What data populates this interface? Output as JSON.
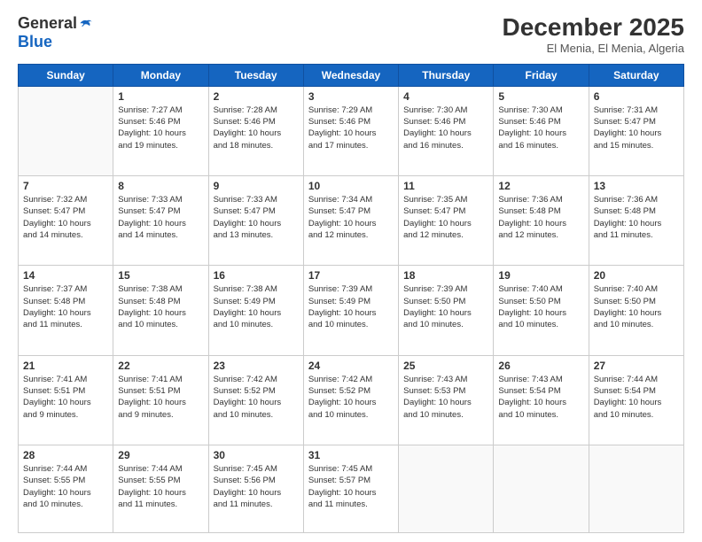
{
  "logo": {
    "general": "General",
    "blue": "Blue"
  },
  "header": {
    "month": "December 2025",
    "location": "El Menia, El Menia, Algeria"
  },
  "days_of_week": [
    "Sunday",
    "Monday",
    "Tuesday",
    "Wednesday",
    "Thursday",
    "Friday",
    "Saturday"
  ],
  "weeks": [
    [
      {
        "day": "",
        "info": ""
      },
      {
        "day": "1",
        "info": "Sunrise: 7:27 AM\nSunset: 5:46 PM\nDaylight: 10 hours\nand 19 minutes."
      },
      {
        "day": "2",
        "info": "Sunrise: 7:28 AM\nSunset: 5:46 PM\nDaylight: 10 hours\nand 18 minutes."
      },
      {
        "day": "3",
        "info": "Sunrise: 7:29 AM\nSunset: 5:46 PM\nDaylight: 10 hours\nand 17 minutes."
      },
      {
        "day": "4",
        "info": "Sunrise: 7:30 AM\nSunset: 5:46 PM\nDaylight: 10 hours\nand 16 minutes."
      },
      {
        "day": "5",
        "info": "Sunrise: 7:30 AM\nSunset: 5:46 PM\nDaylight: 10 hours\nand 16 minutes."
      },
      {
        "day": "6",
        "info": "Sunrise: 7:31 AM\nSunset: 5:47 PM\nDaylight: 10 hours\nand 15 minutes."
      }
    ],
    [
      {
        "day": "7",
        "info": "Sunrise: 7:32 AM\nSunset: 5:47 PM\nDaylight: 10 hours\nand 14 minutes."
      },
      {
        "day": "8",
        "info": "Sunrise: 7:33 AM\nSunset: 5:47 PM\nDaylight: 10 hours\nand 14 minutes."
      },
      {
        "day": "9",
        "info": "Sunrise: 7:33 AM\nSunset: 5:47 PM\nDaylight: 10 hours\nand 13 minutes."
      },
      {
        "day": "10",
        "info": "Sunrise: 7:34 AM\nSunset: 5:47 PM\nDaylight: 10 hours\nand 12 minutes."
      },
      {
        "day": "11",
        "info": "Sunrise: 7:35 AM\nSunset: 5:47 PM\nDaylight: 10 hours\nand 12 minutes."
      },
      {
        "day": "12",
        "info": "Sunrise: 7:36 AM\nSunset: 5:48 PM\nDaylight: 10 hours\nand 12 minutes."
      },
      {
        "day": "13",
        "info": "Sunrise: 7:36 AM\nSunset: 5:48 PM\nDaylight: 10 hours\nand 11 minutes."
      }
    ],
    [
      {
        "day": "14",
        "info": "Sunrise: 7:37 AM\nSunset: 5:48 PM\nDaylight: 10 hours\nand 11 minutes."
      },
      {
        "day": "15",
        "info": "Sunrise: 7:38 AM\nSunset: 5:48 PM\nDaylight: 10 hours\nand 10 minutes."
      },
      {
        "day": "16",
        "info": "Sunrise: 7:38 AM\nSunset: 5:49 PM\nDaylight: 10 hours\nand 10 minutes."
      },
      {
        "day": "17",
        "info": "Sunrise: 7:39 AM\nSunset: 5:49 PM\nDaylight: 10 hours\nand 10 minutes."
      },
      {
        "day": "18",
        "info": "Sunrise: 7:39 AM\nSunset: 5:50 PM\nDaylight: 10 hours\nand 10 minutes."
      },
      {
        "day": "19",
        "info": "Sunrise: 7:40 AM\nSunset: 5:50 PM\nDaylight: 10 hours\nand 10 minutes."
      },
      {
        "day": "20",
        "info": "Sunrise: 7:40 AM\nSunset: 5:50 PM\nDaylight: 10 hours\nand 10 minutes."
      }
    ],
    [
      {
        "day": "21",
        "info": "Sunrise: 7:41 AM\nSunset: 5:51 PM\nDaylight: 10 hours\nand 9 minutes."
      },
      {
        "day": "22",
        "info": "Sunrise: 7:41 AM\nSunset: 5:51 PM\nDaylight: 10 hours\nand 9 minutes."
      },
      {
        "day": "23",
        "info": "Sunrise: 7:42 AM\nSunset: 5:52 PM\nDaylight: 10 hours\nand 10 minutes."
      },
      {
        "day": "24",
        "info": "Sunrise: 7:42 AM\nSunset: 5:52 PM\nDaylight: 10 hours\nand 10 minutes."
      },
      {
        "day": "25",
        "info": "Sunrise: 7:43 AM\nSunset: 5:53 PM\nDaylight: 10 hours\nand 10 minutes."
      },
      {
        "day": "26",
        "info": "Sunrise: 7:43 AM\nSunset: 5:54 PM\nDaylight: 10 hours\nand 10 minutes."
      },
      {
        "day": "27",
        "info": "Sunrise: 7:44 AM\nSunset: 5:54 PM\nDaylight: 10 hours\nand 10 minutes."
      }
    ],
    [
      {
        "day": "28",
        "info": "Sunrise: 7:44 AM\nSunset: 5:55 PM\nDaylight: 10 hours\nand 10 minutes."
      },
      {
        "day": "29",
        "info": "Sunrise: 7:44 AM\nSunset: 5:55 PM\nDaylight: 10 hours\nand 11 minutes."
      },
      {
        "day": "30",
        "info": "Sunrise: 7:45 AM\nSunset: 5:56 PM\nDaylight: 10 hours\nand 11 minutes."
      },
      {
        "day": "31",
        "info": "Sunrise: 7:45 AM\nSunset: 5:57 PM\nDaylight: 10 hours\nand 11 minutes."
      },
      {
        "day": "",
        "info": ""
      },
      {
        "day": "",
        "info": ""
      },
      {
        "day": "",
        "info": ""
      }
    ]
  ]
}
